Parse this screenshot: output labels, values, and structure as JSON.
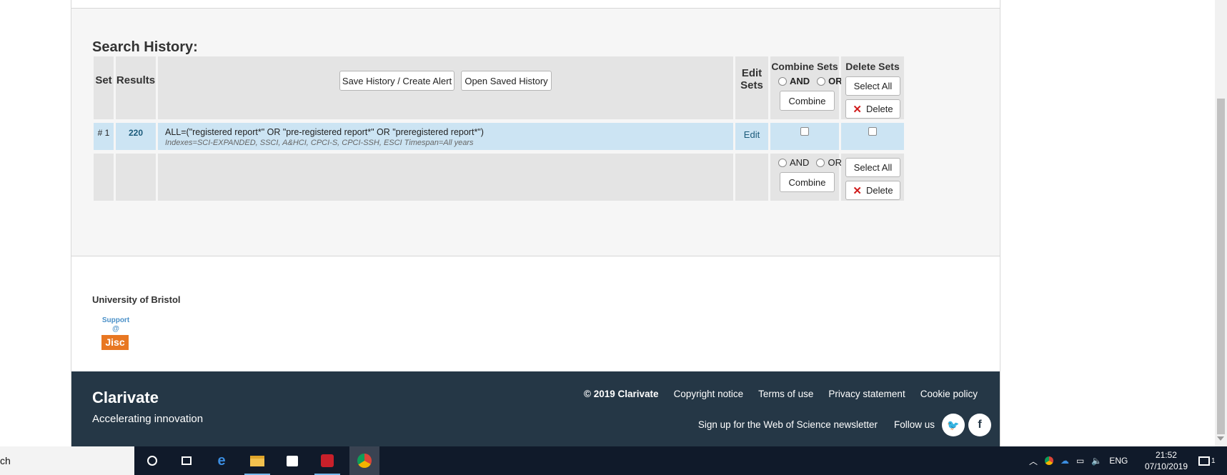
{
  "history": {
    "title": "Search History:",
    "headers": {
      "set": "Set",
      "results": "Results",
      "edit_line1": "Edit",
      "edit_line2": "Sets",
      "combine": "Combine Sets",
      "delete": "Delete Sets"
    },
    "save_button": "Save History / Create Alert",
    "open_button": "Open Saved History",
    "and_label": "AND",
    "or_label": "OR",
    "combine_button": "Combine",
    "select_all_button": "Select All",
    "delete_button": "Delete",
    "rows": [
      {
        "set": "# 1",
        "results": "220",
        "query": "ALL=(\"registered report*\" OR \"pre-registered report*\" OR \"preregistered report*\")",
        "meta": "Indexes=SCI-EXPANDED, SSCI, A&HCI, CPCI-S, CPCI-SSH, ESCI Timespan=All years",
        "edit": "Edit"
      }
    ]
  },
  "institution": {
    "name": "University of Bristol",
    "support_line1": "Support",
    "support_line2": "@",
    "logo_text": "Jisc"
  },
  "footer": {
    "brand": "Clarivate",
    "tagline": "Accelerating innovation",
    "links": [
      "© 2019 Clarivate",
      "Copyright notice",
      "Terms of use",
      "Privacy statement",
      "Cookie policy"
    ],
    "newsletter": "Sign up for the Web of Science newsletter",
    "follow": "Follow us",
    "twitter_glyph": "🐦",
    "facebook_glyph": "f"
  },
  "taskbar": {
    "search_text": "ch",
    "language": "ENG",
    "time": "21:52",
    "date": "07/10/2019",
    "notification_count": "1"
  }
}
